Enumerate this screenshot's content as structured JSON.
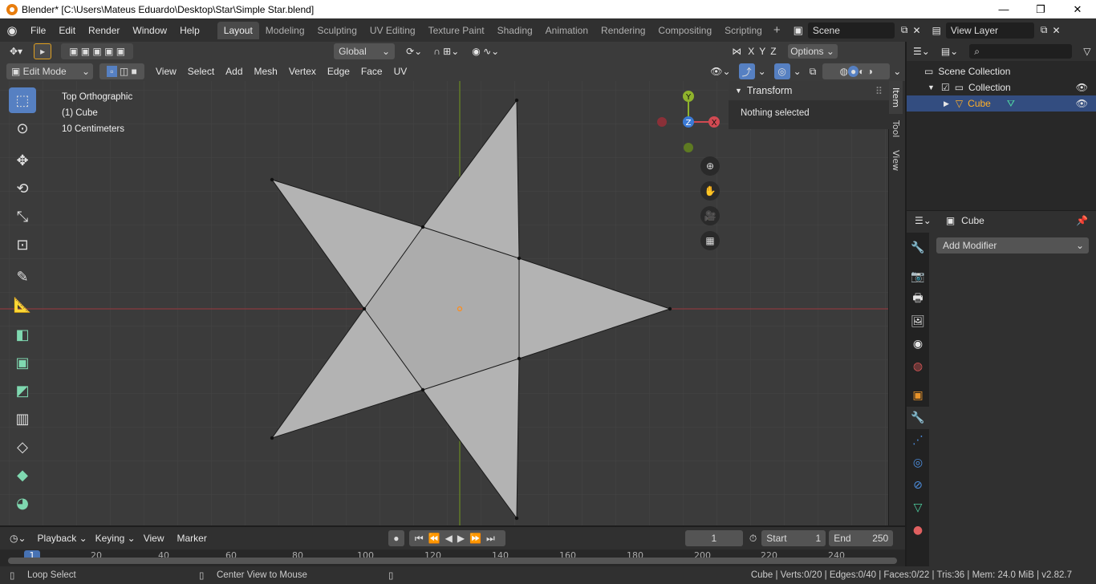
{
  "window": {
    "title": "Blender* [C:\\Users\\Mateus Eduardo\\Desktop\\Star\\Simple Star.blend]",
    "minimize": "—",
    "maximize": "❐",
    "close": "✕"
  },
  "menubar": {
    "items": [
      "File",
      "Edit",
      "Render",
      "Window",
      "Help"
    ]
  },
  "workspaces": [
    "Layout",
    "Modeling",
    "Sculpting",
    "UV Editing",
    "Texture Paint",
    "Shading",
    "Animation",
    "Rendering",
    "Compositing",
    "Scripting"
  ],
  "active_workspace": "Layout",
  "scene": {
    "name": "Scene",
    "view_layer": "View Layer"
  },
  "viewport_header": {
    "orientation": "Global",
    "options": "Options",
    "mode": "Edit Mode",
    "menus": [
      "View",
      "Select",
      "Add",
      "Mesh",
      "Vertex",
      "Edge",
      "Face",
      "UV"
    ],
    "axes": [
      "X",
      "Y",
      "Z"
    ]
  },
  "overlay": {
    "view": "Top Orthographic",
    "object": "(1) Cube",
    "scale": "10 Centimeters"
  },
  "gizmo": {
    "y": "Y",
    "z": "Z",
    "x": "X"
  },
  "npanel": {
    "section": "Transform",
    "message": "Nothing selected",
    "tabs": [
      "Item",
      "Tool",
      "View"
    ]
  },
  "outliner": {
    "scene_collection": "Scene Collection",
    "collection": "Collection",
    "object": "Cube"
  },
  "properties": {
    "object": "Cube",
    "add_modifier": "Add Modifier"
  },
  "timeline": {
    "menus": [
      "Playback",
      "Keying",
      "View",
      "Marker"
    ],
    "current_frame": "1",
    "start_label": "Start",
    "start": "1",
    "end_label": "End",
    "end": "250",
    "ticks": [
      "1",
      "20",
      "40",
      "60",
      "80",
      "100",
      "120",
      "140",
      "160",
      "180",
      "200",
      "220",
      "240"
    ]
  },
  "statusbar": {
    "left": "Loop Select",
    "middle": "Center View to Mouse",
    "right": "Cube | Verts:0/20 | Edges:0/40 | Faces:0/22 | Tris:36 | Mem: 24.0 MiB | v2.82.7"
  },
  "colors": {
    "accent": "#5680c2",
    "x_axis": "#c8403f",
    "y_axis": "#6f9f1f",
    "z_axis": "#3b7ad6",
    "mesh": "#b7b7b7",
    "object_highlight": "#ffaf29"
  }
}
